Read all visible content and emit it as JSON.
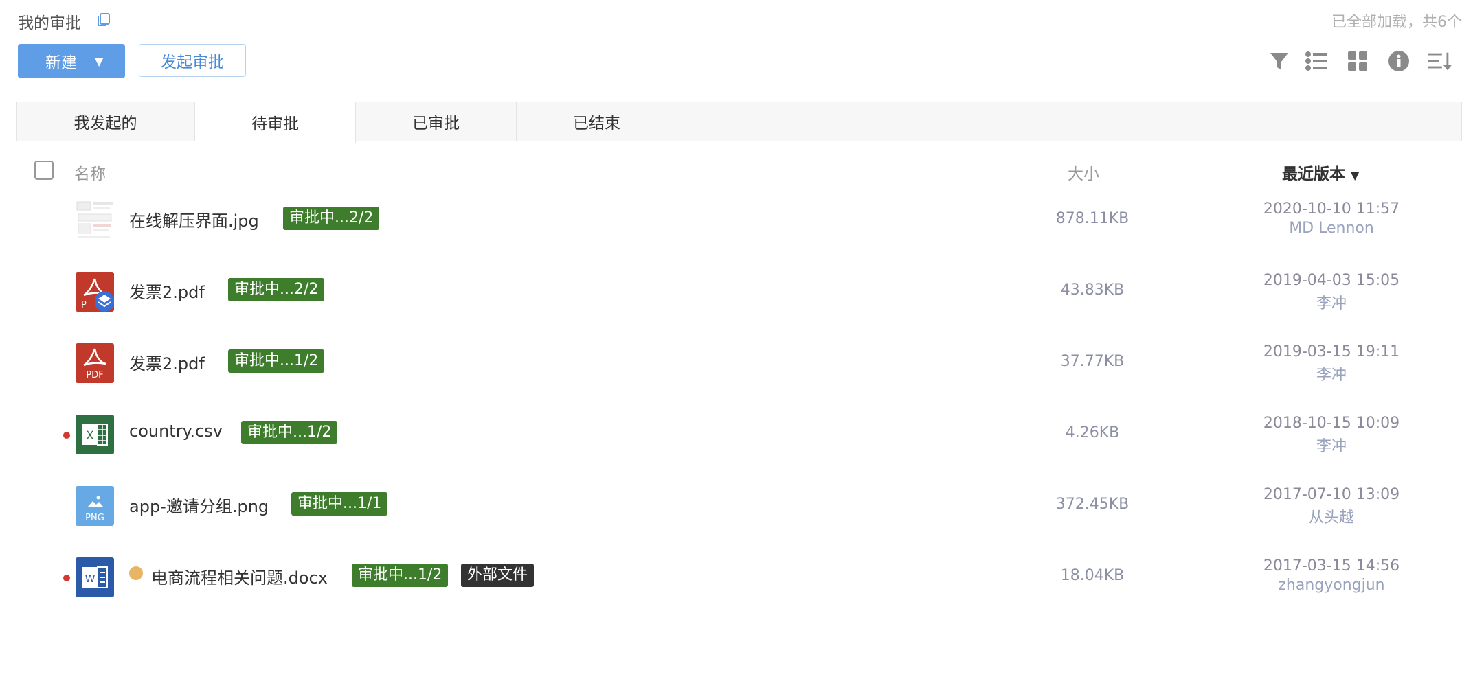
{
  "header": {
    "title": "我的审批",
    "status": "已全部加载，共6个"
  },
  "toolbar": {
    "new_label": "新建",
    "start_label": "发起审批",
    "icons": [
      "filter-icon",
      "list-view-icon",
      "grid-view-icon",
      "info-icon",
      "sort-icon"
    ]
  },
  "tabs": [
    {
      "label": "我发起的",
      "active": false
    },
    {
      "label": "待审批",
      "active": true
    },
    {
      "label": "已审批",
      "active": false
    },
    {
      "label": "已结束",
      "active": false
    }
  ],
  "columns": {
    "name": "名称",
    "size": "大小",
    "version": "最近版本"
  },
  "files": [
    {
      "name": "在线解压界面.jpg",
      "icon": "image-thumbnail-icon",
      "badge": "审批中...2/2",
      "size": "878.11KB",
      "date": "2020-10-10 11:57",
      "owner": "MD Lennon"
    },
    {
      "name": "发票2.pdf",
      "icon": "pdf-icon",
      "badge": "审批中...2/2",
      "size": "43.83KB",
      "date": "2019-04-03 15:05",
      "owner": "李冲"
    },
    {
      "name": "发票2.pdf",
      "icon": "pdf-icon",
      "icon_text": "PDF",
      "badge": "审批中...1/2",
      "size": "37.77KB",
      "date": "2019-03-15 19:11",
      "owner": "李冲"
    },
    {
      "name": "country.csv",
      "icon": "excel-icon",
      "badge": "审批中...1/2",
      "size": "4.26KB",
      "date": "2018-10-15 10:09",
      "owner": "李冲"
    },
    {
      "name": "app-邀请分组.png",
      "icon": "png-icon",
      "icon_text": "PNG",
      "badge": "审批中...1/1",
      "size": "372.45KB",
      "date": "2017-07-10 13:09",
      "owner": "从头越"
    },
    {
      "name": "电商流程相关问题.docx",
      "icon": "word-icon",
      "badge": "审批中...1/2",
      "badge2": "外部文件",
      "size": "18.04KB",
      "date": "2017-03-15 14:56",
      "owner": "zhangyongjun"
    }
  ]
}
